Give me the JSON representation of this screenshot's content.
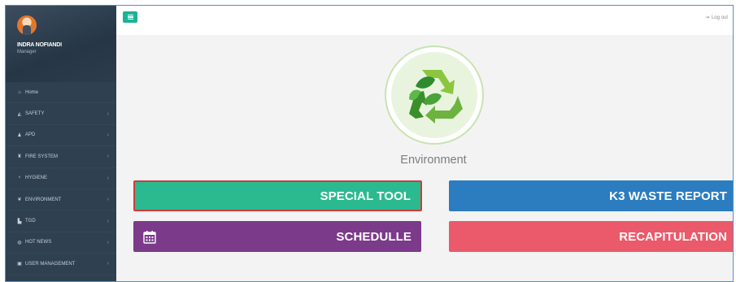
{
  "profile": {
    "name": "INDRA NOFIANDI",
    "role": "Manager"
  },
  "sidebar": {
    "items": [
      {
        "label": "Home",
        "icon": "home-icon",
        "glyph": "⌂",
        "has_submenu": false
      },
      {
        "label": "SAFETY",
        "icon": "thumbs-up-icon",
        "glyph": "◭",
        "has_submenu": true
      },
      {
        "label": "APD",
        "icon": "user-icon",
        "glyph": "♟",
        "has_submenu": true
      },
      {
        "label": "FIRE SYSTEM",
        "icon": "fire-extinguisher-icon",
        "glyph": "♜",
        "has_submenu": true
      },
      {
        "label": "HYGIENE",
        "icon": "shower-icon",
        "glyph": "♆",
        "has_submenu": true
      },
      {
        "label": "ENVIRONMENT",
        "icon": "leaf-icon",
        "glyph": "❦",
        "has_submenu": true
      },
      {
        "label": "TGD",
        "icon": "chart-icon",
        "glyph": "▙",
        "has_submenu": true
      },
      {
        "label": "HOT NEWS",
        "icon": "globe-icon",
        "glyph": "◍",
        "has_submenu": true
      },
      {
        "label": "USER MANAGEMENT",
        "icon": "lock-icon",
        "glyph": "▣",
        "has_submenu": true
      }
    ],
    "chevron": "‹"
  },
  "topbar": {
    "logout_label": "Log out",
    "logout_glyph": "⇥"
  },
  "main": {
    "section_title": "Environment",
    "tiles": {
      "special_tool": "SPECIAL TOOL",
      "k3_waste_report": "K3 WASTE REPORT",
      "schedulle": "SCHEDULLE",
      "recapitulation": "RECAPITULATION"
    }
  },
  "colors": {
    "sidebar_bg": "#2f4050",
    "accent": "#1ab394",
    "special_tool": "#2bba8f",
    "k3_waste_report": "#2b7dc0",
    "schedulle": "#7b3a8a",
    "recapitulation": "#ea5a6a",
    "selection_border": "#d23b3b"
  }
}
